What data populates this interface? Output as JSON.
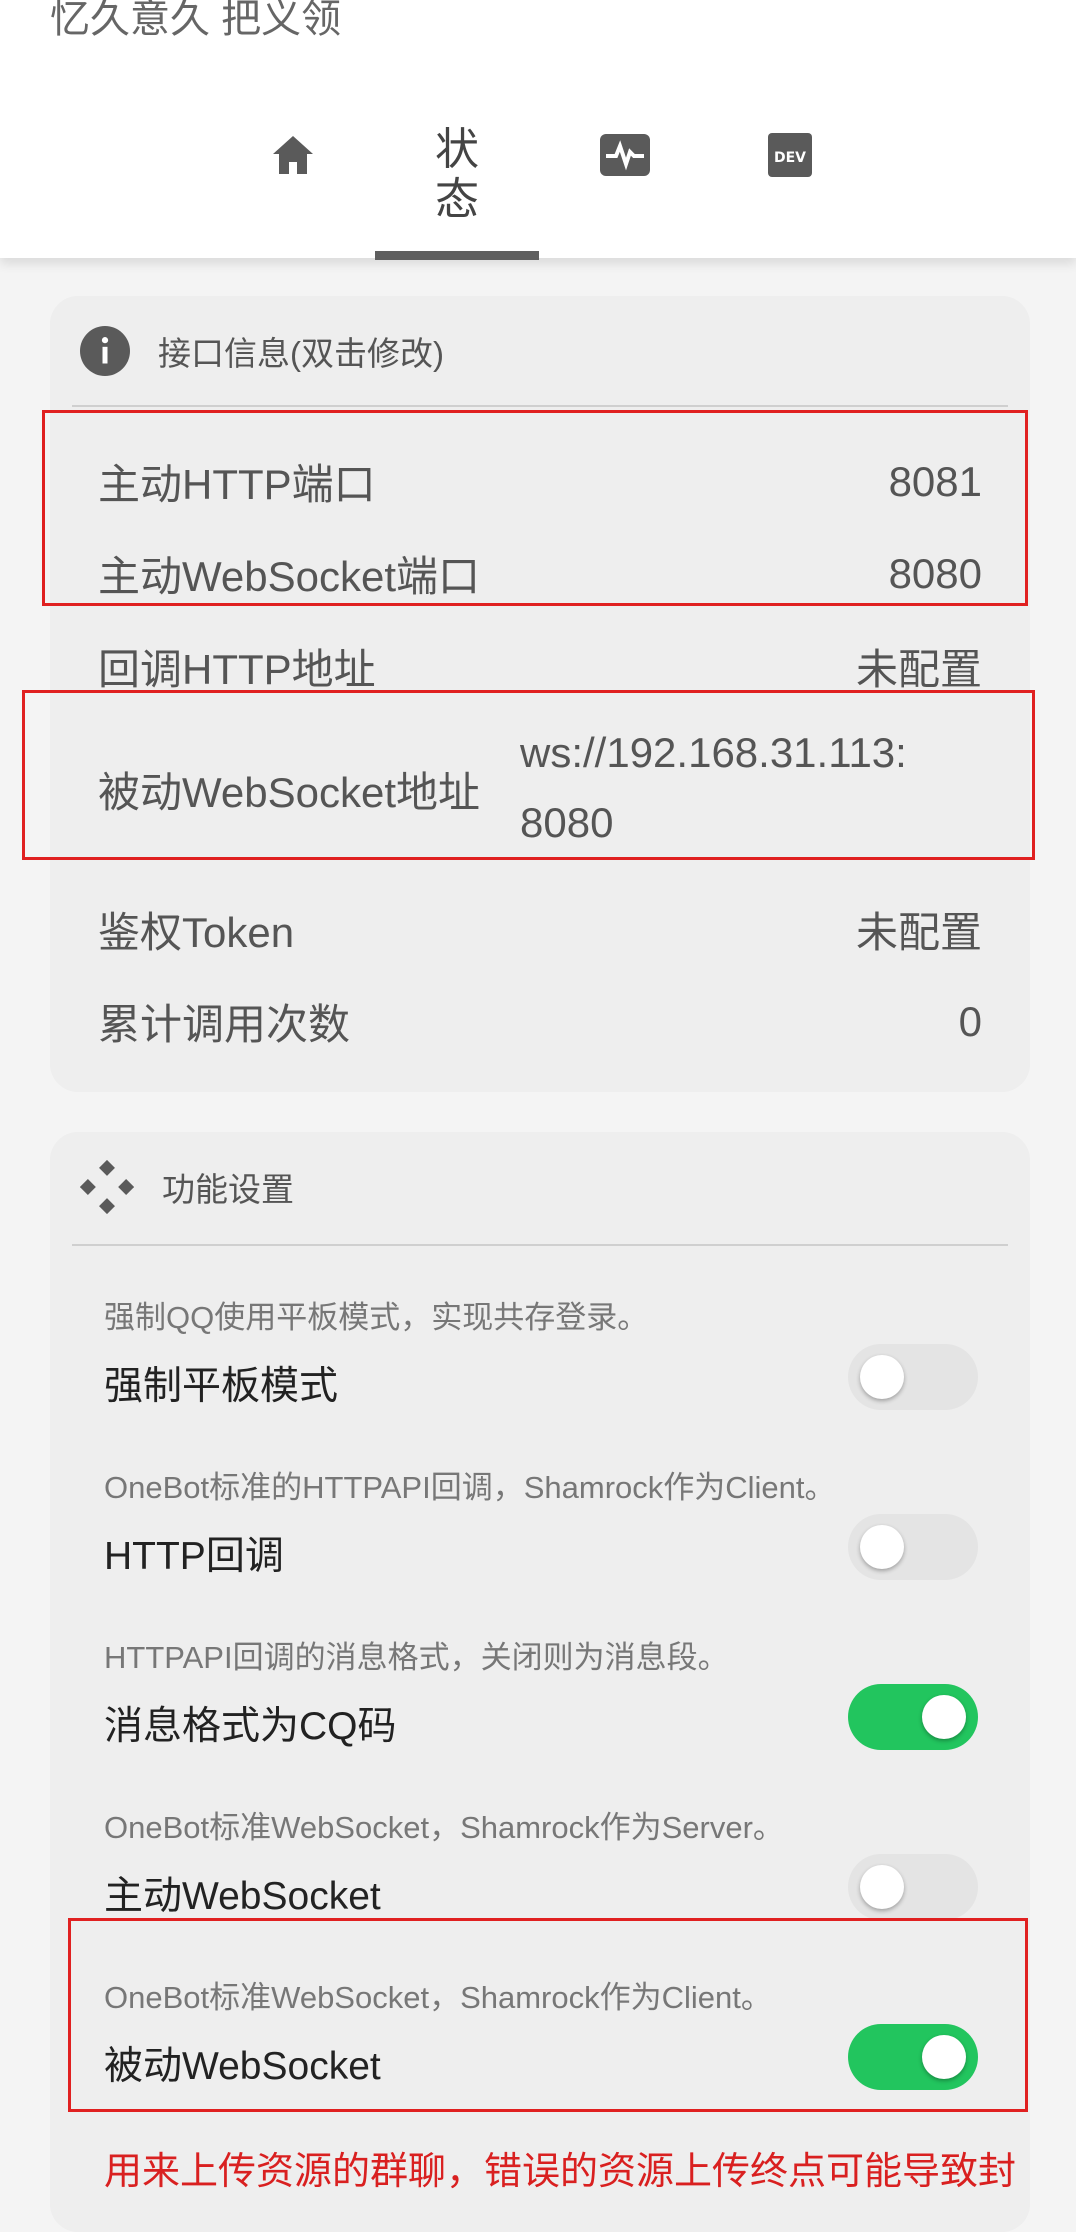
{
  "app_title": "忆久意久 把义领",
  "tabs": [
    {
      "name": "home",
      "icon": "home-icon"
    },
    {
      "name": "status",
      "label_line1": "状",
      "label_line2": "态"
    },
    {
      "name": "activity",
      "icon": "activity-monitor-icon"
    },
    {
      "name": "dev",
      "icon": "dev-icon",
      "icon_text": "DEV"
    }
  ],
  "interface_info": {
    "title": "接口信息(双击修改)",
    "rows": [
      {
        "label": "主动HTTP端口",
        "value": "8081"
      },
      {
        "label": "主动WebSocket端口",
        "value": "8080"
      },
      {
        "label": "回调HTTP地址",
        "value": "未配置"
      },
      {
        "label": "被动WebSocket地址",
        "value_line1": "ws://192.168.31.113:",
        "value_line2": "8080"
      },
      {
        "label": "鉴权Token",
        "value": "未配置"
      },
      {
        "label": "累计调用次数",
        "value": "0"
      }
    ]
  },
  "feature_settings": {
    "title": "功能设置",
    "items": [
      {
        "desc": "强制QQ使用平板模式，实现共存登录。",
        "title": "强制平板模式",
        "enabled": false
      },
      {
        "desc": "OneBot标准的HTTPAPI回调，Shamrock作为Client。",
        "title": "HTTP回调",
        "enabled": false
      },
      {
        "desc": "HTTPAPI回调的消息格式，关闭则为消息段。",
        "title": "消息格式为CQ码",
        "enabled": true
      },
      {
        "desc": "OneBot标准WebSocket，Shamrock作为Server。",
        "title": "主动WebSocket",
        "enabled": false
      },
      {
        "desc": "OneBot标准WebSocket，Shamrock作为Client。",
        "title": "被动WebSocket",
        "enabled": true
      }
    ],
    "warning": "用来上传资源的群聊，错误的资源上传终点可能导致封"
  },
  "colors": {
    "toggle_on": "#22c55e",
    "highlight": "#e02020",
    "warning": "#d92020"
  }
}
